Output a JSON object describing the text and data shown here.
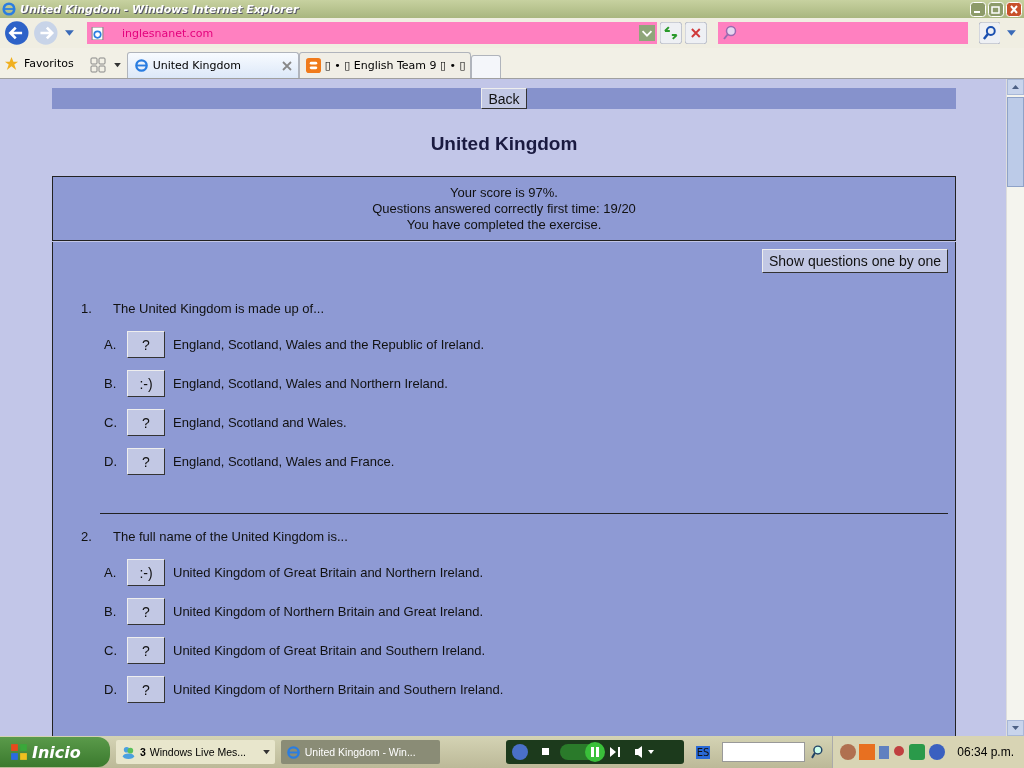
{
  "window": {
    "title": "United Kingdom - Windows Internet Explorer"
  },
  "address_bar": {
    "domain": "inglesnanet.com"
  },
  "favorites": {
    "label": "Favoritos"
  },
  "tabs": [
    {
      "label": "United Kingdom",
      "kind": "page",
      "selected": true
    },
    {
      "label": "▯ • ▯ English Team 9 ▯ • ▯",
      "kind": "blog",
      "selected": false
    }
  ],
  "page": {
    "back_button": "Back",
    "title": "United Kingdom",
    "score_lines": [
      "Your score is 97%.",
      "Questions answered correctly first time: 19/20",
      "You have completed the exercise."
    ],
    "show_button": "Show questions one by one",
    "questions": [
      {
        "number": "1.",
        "text": "The United Kingdom is made up of...",
        "options": [
          {
            "letter": "A.",
            "mark": "?",
            "text": "England, Scotland, Wales and the Republic of Ireland."
          },
          {
            "letter": "B.",
            "mark": ":-)",
            "text": "England, Scotland, Wales and Northern Ireland."
          },
          {
            "letter": "C.",
            "mark": "?",
            "text": "England, Scotland and Wales."
          },
          {
            "letter": "D.",
            "mark": "?",
            "text": "England, Scotland, Wales and France."
          }
        ]
      },
      {
        "number": "2.",
        "text": "The full name of the United Kingdom is...",
        "options": [
          {
            "letter": "A.",
            "mark": ":-)",
            "text": "United Kingdom of Great Britain and Northern Ireland."
          },
          {
            "letter": "B.",
            "mark": "?",
            "text": "United Kingdom of Northern Britain and Great Ireland."
          },
          {
            "letter": "C.",
            "mark": "?",
            "text": "United Kingdom of Great Britain and Southern Ireland."
          },
          {
            "letter": "D.",
            "mark": "?",
            "text": "United Kingdom of Northern Britain and Southern Ireland."
          }
        ]
      }
    ]
  },
  "taskbar": {
    "start": "Inicio",
    "tasks": [
      {
        "count": "3",
        "label": "Windows Live Mes...",
        "selected": false
      },
      {
        "label": "United Kingdom - Win...",
        "selected": true
      }
    ],
    "language": "ES",
    "clock": "06:34 p.m."
  }
}
